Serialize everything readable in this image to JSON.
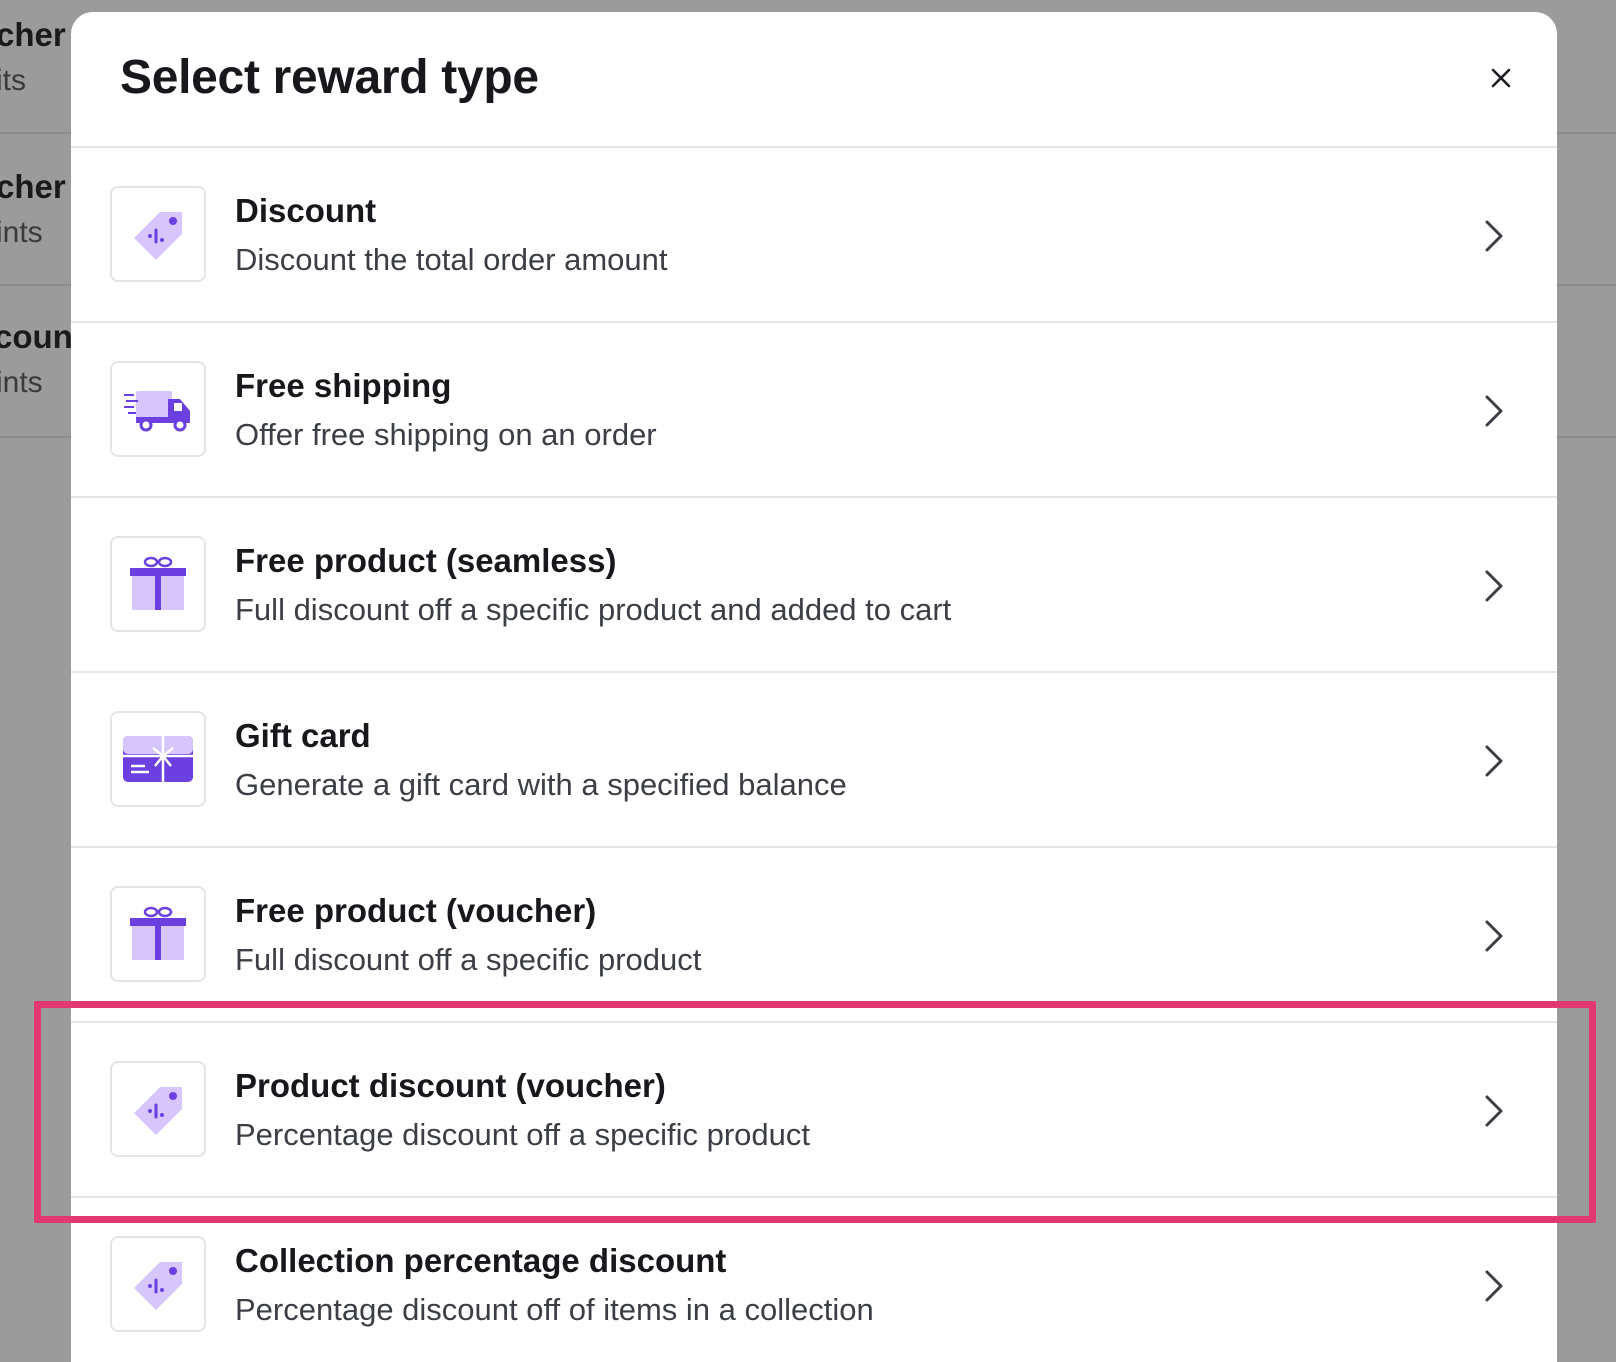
{
  "background_list": [
    {
      "title": "cher",
      "subtitle": "its"
    },
    {
      "title": "cher",
      "subtitle": "ints"
    },
    {
      "title": "count",
      "subtitle": "ints"
    }
  ],
  "modal": {
    "title": "Select reward type",
    "close_icon": "close-icon"
  },
  "options": [
    {
      "title": "Discount",
      "description": "Discount the total order amount",
      "icon": "price-tag-icon"
    },
    {
      "title": "Free shipping",
      "description": "Offer free shipping on an order",
      "icon": "delivery-truck-icon"
    },
    {
      "title": "Free product (seamless)",
      "description": "Full discount off a specific product and added to cart",
      "icon": "gift-box-icon"
    },
    {
      "title": "Gift card",
      "description": "Generate a gift card with a specified balance",
      "icon": "gift-card-icon"
    },
    {
      "title": "Free product (voucher)",
      "description": "Full discount off a specific product",
      "icon": "gift-box-icon"
    },
    {
      "title": "Product discount (voucher)",
      "description": "Percentage discount off a specific product",
      "icon": "price-tag-icon"
    },
    {
      "title": "Collection percentage discount",
      "description": "Percentage discount off of items in a collection",
      "icon": "price-tag-icon"
    }
  ],
  "colors": {
    "accent_purple": "#6b3fe0",
    "light_purple": "#d6c6fb",
    "highlight": "#e23772"
  },
  "highlighted_option": "Product discount (voucher)"
}
